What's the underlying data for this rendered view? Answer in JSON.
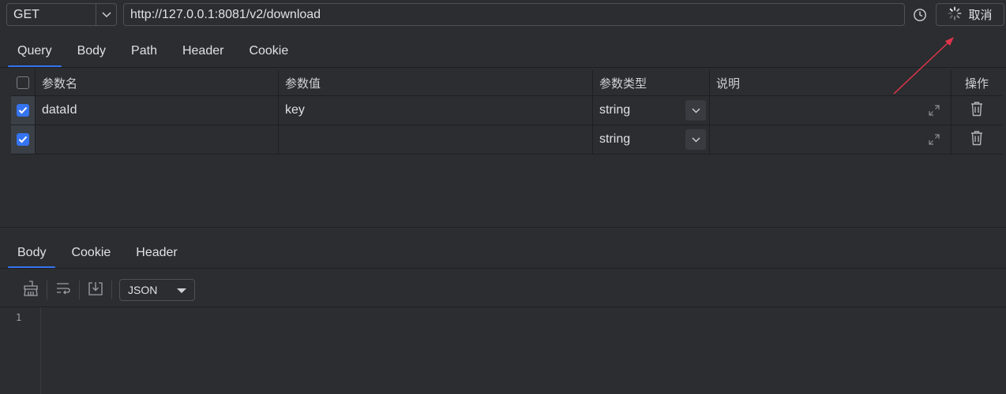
{
  "request": {
    "method": "GET",
    "url": "http://127.0.0.1:8081/v2/download",
    "cancel_label": "取消"
  },
  "request_tabs": [
    "Query",
    "Body",
    "Path",
    "Header",
    "Cookie"
  ],
  "query_table": {
    "headers": [
      "参数名",
      "参数值",
      "参数类型",
      "说明",
      "操作"
    ],
    "rows": [
      {
        "checked": true,
        "name": "dataId",
        "value": "key",
        "type": "string",
        "description": ""
      },
      {
        "checked": true,
        "name": "",
        "value": "",
        "type": "string",
        "description": ""
      }
    ]
  },
  "response_tabs": [
    "Body",
    "Cookie",
    "Header"
  ],
  "response_toolbar": {
    "format": "JSON"
  },
  "editor": {
    "line_numbers": [
      "1"
    ]
  },
  "colors": {
    "accent": "#3574f0",
    "annotation_arrow": "#e0344a",
    "background": "#2b2d30"
  }
}
